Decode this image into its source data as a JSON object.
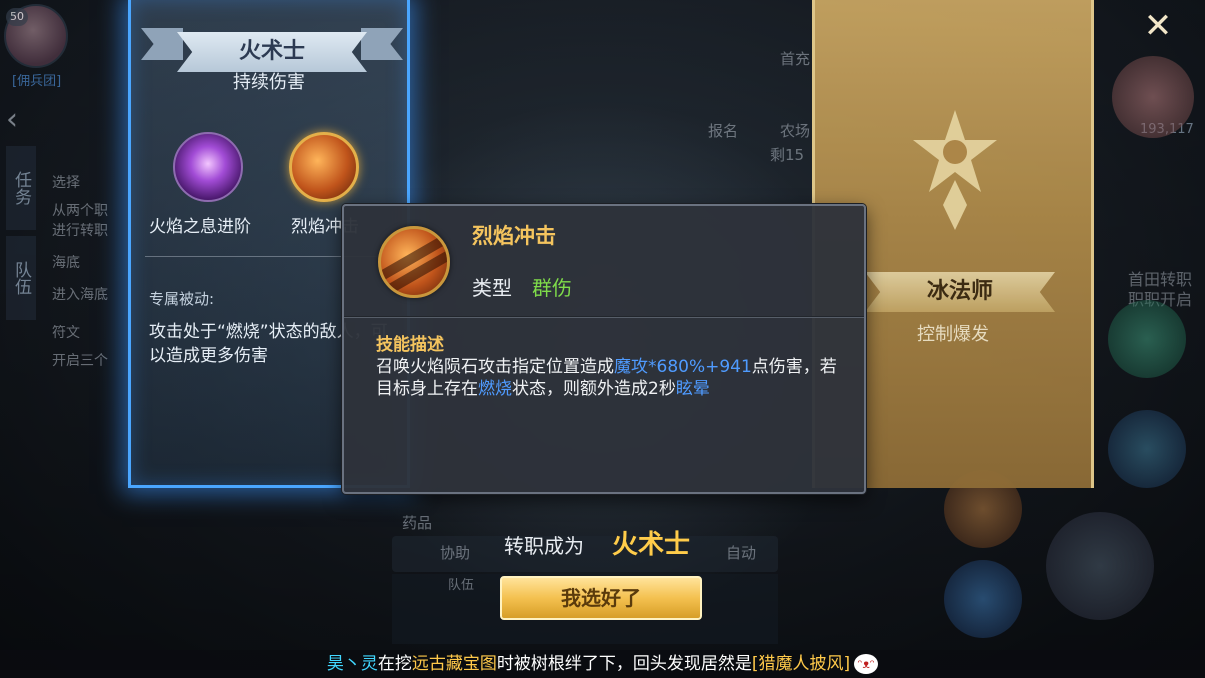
{
  "background": {
    "level": "50",
    "guild_tag": "[佣兵团]",
    "tabs": [
      "任务",
      "队伍"
    ],
    "quest_lines": [
      "选择",
      "从两个职",
      "进行转职",
      "海底",
      "进入海底",
      "符文",
      "开启三个"
    ],
    "top_icons": [
      "首充",
      "报名",
      "农场",
      "剩15"
    ],
    "right_labels": [
      "首田转职",
      "职职开启"
    ],
    "power": "193,117",
    "bottom_labels": [
      "药品",
      "协助",
      "自动",
      "队伍"
    ]
  },
  "left_card": {
    "title": "火术士",
    "subtitle": "持续伤害",
    "skills": [
      {
        "label": "火焰之息进阶",
        "icon": "purple-flame-orb-icon"
      },
      {
        "label": "烈焰冲击",
        "icon": "fire-meteor-orb-icon"
      }
    ],
    "passive_title": "专属被动:",
    "passive_desc": "攻击处于“燃烧”状态的敌人，可以造成更多伤害"
  },
  "right_card": {
    "title": "冰法师",
    "subtitle": "控制爆发",
    "emblem": "frost-emblem-icon"
  },
  "tooltip": {
    "name": "烈焰冲击",
    "type_label": "类型",
    "type_value": "群伤",
    "desc_title": "技能描述",
    "desc_parts": {
      "p1": "召唤火焰陨石攻击指定位置造成",
      "h1": "魔攻*680%+941",
      "p2": "点伤害，若目标身上存在",
      "h2": "燃烧",
      "p3": "状态，则额外造成2秒",
      "h3": "眩晕"
    }
  },
  "transfer": {
    "label": "转职成为",
    "class_name": "火术士",
    "confirm_label": "我选好了"
  },
  "ticker": {
    "player": "昊丶灵",
    "text1": "在挖",
    "place": "远古藏宝图",
    "text2": "时被树根绊了下，回头发现居然是",
    "item": "[猎魔人披风]"
  },
  "colors": {
    "highlight_blue": "#4f9bff",
    "type_green": "#7fdc4a",
    "gold": "#f4c45e",
    "card_glow": "#4aa6ff"
  }
}
